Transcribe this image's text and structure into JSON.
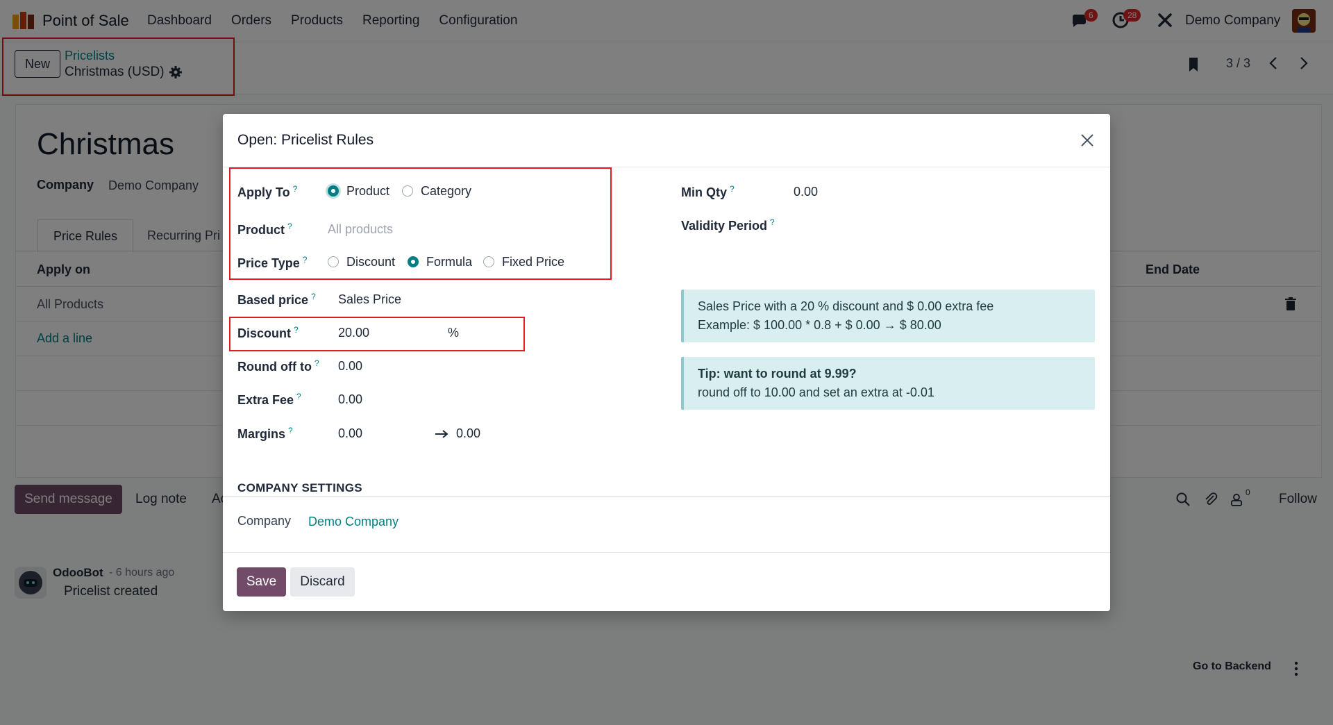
{
  "app": {
    "name": "Point of Sale",
    "menu": [
      "Dashboard",
      "Orders",
      "Products",
      "Reporting",
      "Configuration"
    ],
    "messages_count": "6",
    "activities_count": "28",
    "company": "Demo Company",
    "accent_color": "#714b67",
    "link_color": "#017e84",
    "highlight_color": "#e11d24"
  },
  "control_panel": {
    "new_label": "New",
    "breadcrumb_parent": "Pricelists",
    "breadcrumb_current": "Christmas (USD)",
    "pager": "3 / 3"
  },
  "record": {
    "title": "Christmas",
    "company_label": "Company",
    "company_value": "Demo Company",
    "tabs": [
      "Price Rules",
      "Recurring Pri"
    ],
    "columns": {
      "apply_on": "Apply on",
      "end_date": "End Date"
    },
    "rows": [
      {
        "apply_on": "All Products"
      }
    ],
    "add_line": "Add a line"
  },
  "chatter": {
    "send_message": "Send message",
    "log_note": "Log note",
    "activities": "Ac",
    "followers_count": "0",
    "follow": "Follow",
    "message": {
      "author": "OdooBot",
      "time": "- 6 hours ago",
      "body": "Pricelist created"
    }
  },
  "footer": {
    "go_to_backend": "Go to Backend"
  },
  "dialog": {
    "title": "Open: Pricelist Rules",
    "fields": {
      "apply_to": {
        "label": "Apply To",
        "options": [
          "Product",
          "Category"
        ],
        "selected": "Product"
      },
      "product": {
        "label": "Product",
        "placeholder": "All products"
      },
      "price_type": {
        "label": "Price Type",
        "options": [
          "Discount",
          "Formula",
          "Fixed Price"
        ],
        "selected": "Formula"
      },
      "based_price": {
        "label": "Based price",
        "value": "Sales Price"
      },
      "discount": {
        "label": "Discount",
        "value": "20.00",
        "unit": "%"
      },
      "round_off": {
        "label": "Round off to",
        "value": "0.00"
      },
      "extra_fee": {
        "label": "Extra Fee",
        "value": "0.00"
      },
      "margins": {
        "label": "Margins",
        "min": "0.00",
        "max": "0.00"
      },
      "min_qty": {
        "label": "Min Qty",
        "value": "0.00"
      },
      "validity": {
        "label": "Validity Period"
      }
    },
    "info": {
      "line1": "Sales Price with a 20 % discount and $ 0.00 extra fee",
      "line2": "Example: $ 100.00 * 0.8 + $ 0.00 → $ 80.00"
    },
    "tip": {
      "title": "Tip: want to round at 9.99?",
      "body": "round off to 10.00 and set an extra at -0.01"
    },
    "company_section": {
      "title": "COMPANY SETTINGS",
      "label": "Company",
      "value": "Demo Company"
    },
    "save_label": "Save",
    "discard_label": "Discard",
    "help_mark": "?"
  }
}
